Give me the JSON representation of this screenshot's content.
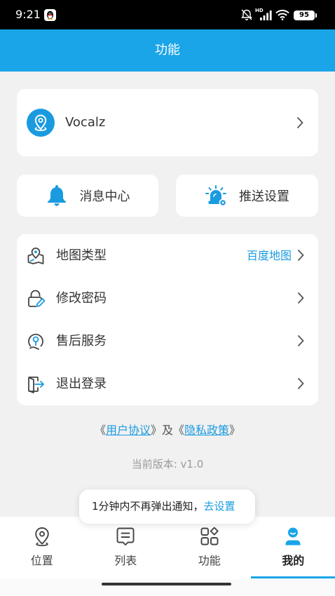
{
  "status_bar": {
    "time": "9:21",
    "network_badge": "HD",
    "battery": "95",
    "icons": [
      "qq-notification-icon",
      "mute-bell-icon",
      "signal-icon",
      "wifi-icon",
      "battery-icon"
    ]
  },
  "header": {
    "title": "功能"
  },
  "profile": {
    "name": "Vocalz",
    "avatar_icon": "location-pin-icon"
  },
  "quick_actions": [
    {
      "label": "消息中心",
      "icon": "bell-icon"
    },
    {
      "label": "推送设置",
      "icon": "alarm-light-icon"
    }
  ],
  "menu": [
    {
      "label": "地图类型",
      "value": "百度地图",
      "icon": "map-icon"
    },
    {
      "label": "修改密码",
      "icon": "lock-edit-icon"
    },
    {
      "label": "售后服务",
      "icon": "service-icon"
    },
    {
      "label": "退出登录",
      "icon": "logout-icon"
    }
  ],
  "agreement": {
    "open": "《",
    "user_agreement": "用户协议",
    "middle": "》及《",
    "privacy_policy": "隐私政策",
    "close": "》"
  },
  "version": "当前版本: v1.0",
  "toast": {
    "message": "1分钟内不再弹出通知，",
    "action": "去设置"
  },
  "bottom_nav": {
    "items": [
      {
        "label": "位置",
        "icon": "location-icon",
        "active": false
      },
      {
        "label": "列表",
        "icon": "list-icon",
        "active": false
      },
      {
        "label": "功能",
        "icon": "apps-icon",
        "active": false
      },
      {
        "label": "我的",
        "icon": "user-icon",
        "active": true
      }
    ]
  },
  "colors": {
    "primary": "#1aa5e8",
    "link": "#1a9be0",
    "background": "#f1f1f1",
    "text": "#333333",
    "muted_text": "#9a9a9a"
  }
}
